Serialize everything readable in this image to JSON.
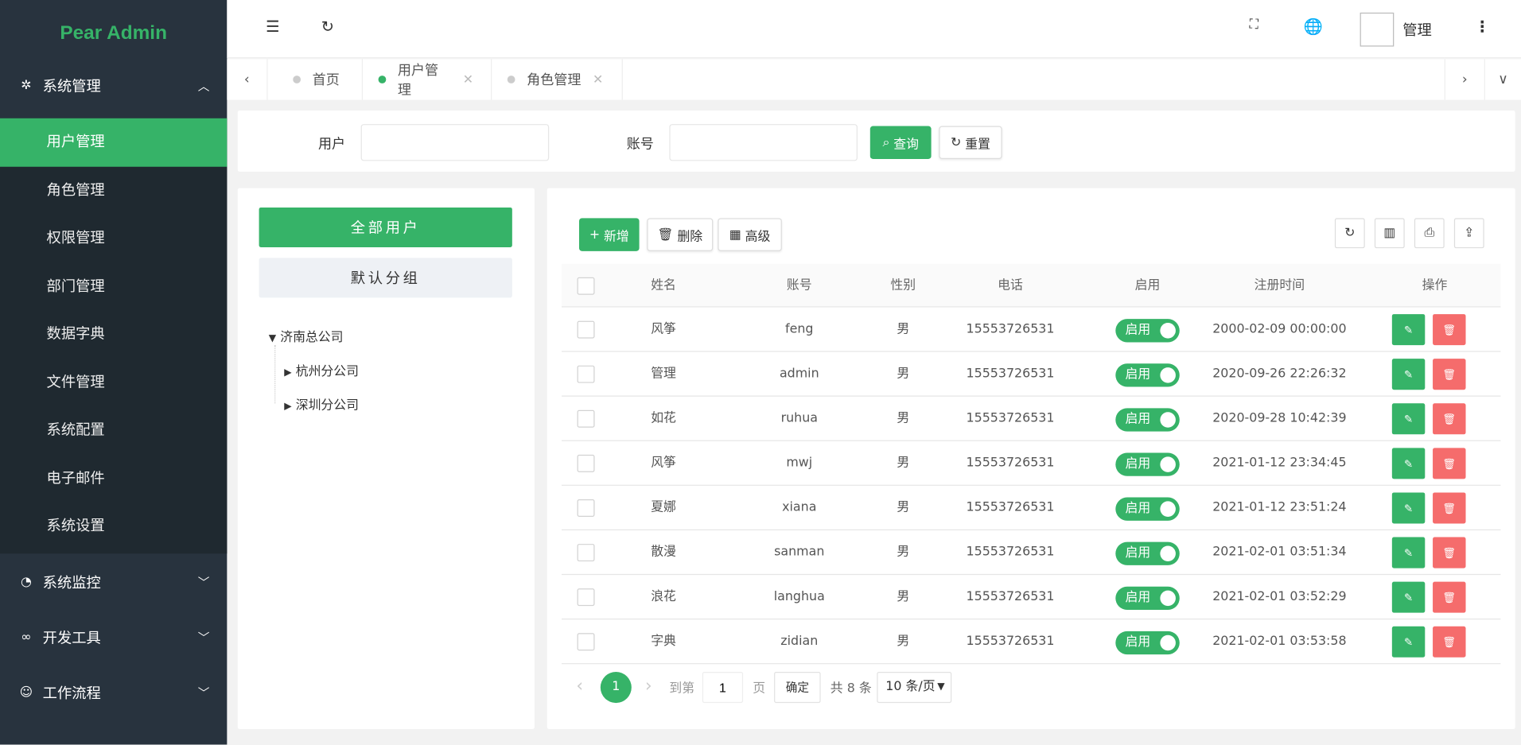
{
  "app": {
    "logo": "Pear Admin",
    "accent": "#36b368",
    "danger": "#f56c6c"
  },
  "sidebar": {
    "groups": [
      {
        "label": "系统管理",
        "icon": "gear-icon",
        "expanded": true,
        "items": [
          {
            "label": "用户管理",
            "active": true
          },
          {
            "label": "角色管理"
          },
          {
            "label": "权限管理"
          },
          {
            "label": "部门管理"
          },
          {
            "label": "数据字典"
          },
          {
            "label": "文件管理"
          },
          {
            "label": "系统配置"
          },
          {
            "label": "电子邮件"
          },
          {
            "label": "系统设置"
          }
        ]
      },
      {
        "label": "系统监控",
        "icon": "gauge-icon"
      },
      {
        "label": "开发工具",
        "icon": "infinity-icon"
      },
      {
        "label": "工作流程",
        "icon": "smile-icon"
      }
    ]
  },
  "header": {
    "user": "管理"
  },
  "tabs": [
    {
      "label": "首页",
      "active": false,
      "closable": false
    },
    {
      "label": "用户管理",
      "active": true,
      "closable": true
    },
    {
      "label": "角色管理",
      "active": false,
      "closable": true
    }
  ],
  "search": {
    "user_label": "用户",
    "account_label": "账号",
    "user_value": "",
    "account_value": "",
    "query": "查询",
    "reset": "重置"
  },
  "groups_panel": {
    "all_users": "全部用户",
    "default_group": "默认分组",
    "tree": {
      "root": "济南总公司",
      "children": [
        "杭州分公司",
        "深圳分公司"
      ]
    }
  },
  "toolbar": {
    "add": "新增",
    "delete": "删除",
    "advanced": "高级"
  },
  "table": {
    "columns": [
      "姓名",
      "账号",
      "性别",
      "电话",
      "启用",
      "注册时间",
      "操作"
    ],
    "rows": [
      {
        "name": "风筝",
        "account": "feng",
        "gender": "男",
        "phone": "15553726531",
        "enabled": "启用",
        "time": "2000-02-09 00:00:00"
      },
      {
        "name": "管理",
        "account": "admin",
        "gender": "男",
        "phone": "15553726531",
        "enabled": "启用",
        "time": "2020-09-26 22:26:32"
      },
      {
        "name": "如花",
        "account": "ruhua",
        "gender": "男",
        "phone": "15553726531",
        "enabled": "启用",
        "time": "2020-09-28 10:42:39"
      },
      {
        "name": "风筝",
        "account": "mwj",
        "gender": "男",
        "phone": "15553726531",
        "enabled": "启用",
        "time": "2021-01-12 23:34:45"
      },
      {
        "name": "夏娜",
        "account": "xiana",
        "gender": "男",
        "phone": "15553726531",
        "enabled": "启用",
        "time": "2021-01-12 23:51:24"
      },
      {
        "name": "散漫",
        "account": "sanman",
        "gender": "男",
        "phone": "15553726531",
        "enabled": "启用",
        "time": "2021-02-01 03:51:34"
      },
      {
        "name": "浪花",
        "account": "langhua",
        "gender": "男",
        "phone": "15553726531",
        "enabled": "启用",
        "time": "2021-02-01 03:52:29"
      },
      {
        "name": "字典",
        "account": "zidian",
        "gender": "男",
        "phone": "15553726531",
        "enabled": "启用",
        "time": "2021-02-01 03:53:58"
      }
    ]
  },
  "pagination": {
    "current": "1",
    "goto_label": "到第",
    "page_value": "1",
    "page_unit": "页",
    "confirm": "确定",
    "total": "共 8 条",
    "page_size": "10 条/页"
  }
}
